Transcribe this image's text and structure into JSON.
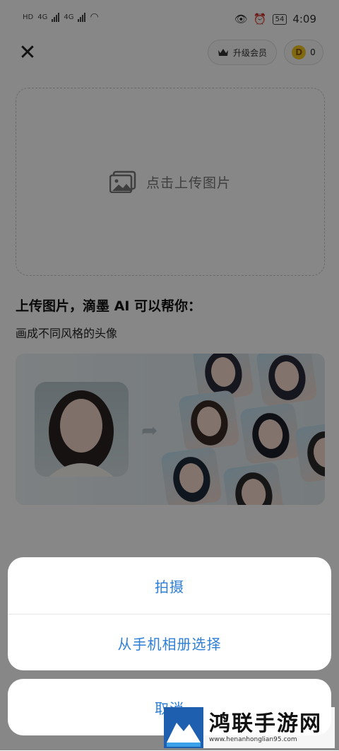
{
  "status_bar": {
    "left_labels": [
      "HD",
      "4G",
      "4G"
    ],
    "battery": "54",
    "time": "4:09"
  },
  "header": {
    "vip_label": "升级会员",
    "coin_letter": "D",
    "coin_count": "0"
  },
  "upload": {
    "label": "点击上传图片"
  },
  "intro": {
    "heading": "上传图片，滴墨 AI 可以帮你：",
    "subtext": "画成不同风格的头像"
  },
  "action_sheet": {
    "options": [
      "拍摄",
      "从手机相册选择"
    ],
    "cancel": "取消"
  },
  "watermark": {
    "title": "鸿联手游网",
    "url": "www.henanhonglian95.com"
  },
  "colors": {
    "action_text": "#2f7fd6",
    "overlay": "rgba(0,0,0,0.47)",
    "coin": "#f3c623"
  }
}
